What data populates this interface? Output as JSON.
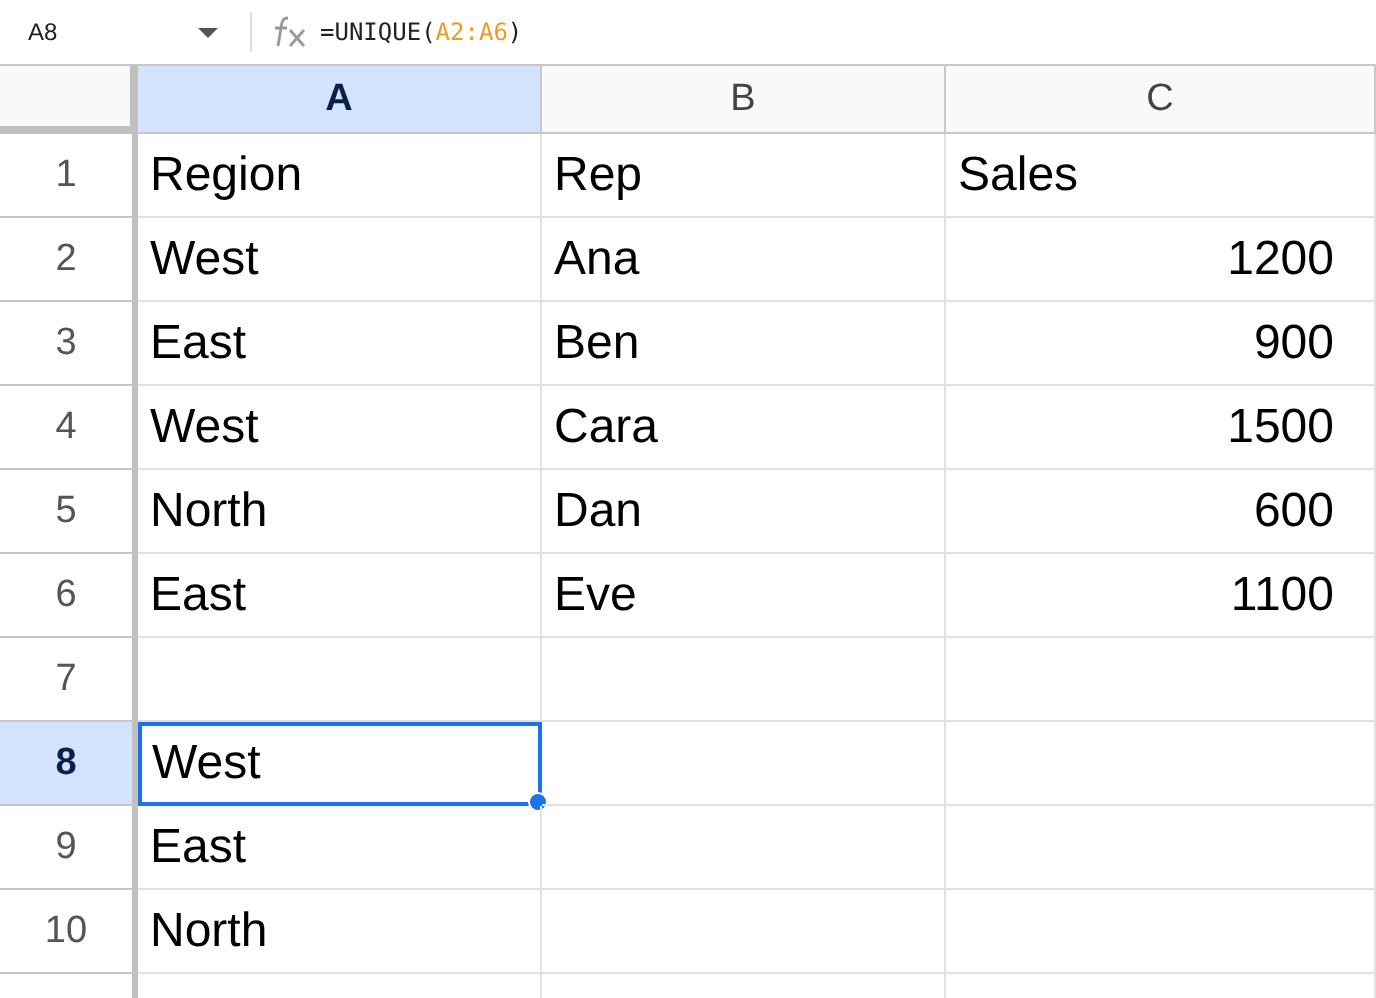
{
  "formula_bar": {
    "cell_ref": "A8",
    "formula_parts": [
      {
        "kind": "text",
        "text": "=UNIQUE("
      },
      {
        "kind": "ref",
        "text": "A2:A6"
      },
      {
        "kind": "text",
        "text": ")"
      }
    ]
  },
  "columns": [
    {
      "label": "A",
      "selected": true
    },
    {
      "label": "B",
      "selected": false
    },
    {
      "label": "C",
      "selected": false
    }
  ],
  "rows": [
    {
      "number": "1",
      "selected": false,
      "cells": [
        {
          "text": "Region",
          "kind": "text",
          "selected": false
        },
        {
          "text": "Rep",
          "kind": "text",
          "selected": false
        },
        {
          "text": "Sales",
          "kind": "text",
          "selected": false
        }
      ]
    },
    {
      "number": "2",
      "selected": false,
      "cells": [
        {
          "text": "West",
          "kind": "text",
          "selected": false
        },
        {
          "text": "Ana",
          "kind": "text",
          "selected": false
        },
        {
          "text": "1200",
          "kind": "number",
          "selected": false
        }
      ]
    },
    {
      "number": "3",
      "selected": false,
      "cells": [
        {
          "text": "East",
          "kind": "text",
          "selected": false
        },
        {
          "text": "Ben",
          "kind": "text",
          "selected": false
        },
        {
          "text": "900",
          "kind": "number",
          "selected": false
        }
      ]
    },
    {
      "number": "4",
      "selected": false,
      "cells": [
        {
          "text": "West",
          "kind": "text",
          "selected": false
        },
        {
          "text": "Cara",
          "kind": "text",
          "selected": false
        },
        {
          "text": "1500",
          "kind": "number",
          "selected": false
        }
      ]
    },
    {
      "number": "5",
      "selected": false,
      "cells": [
        {
          "text": "North",
          "kind": "text",
          "selected": false
        },
        {
          "text": "Dan",
          "kind": "text",
          "selected": false
        },
        {
          "text": "600",
          "kind": "number",
          "selected": false
        }
      ]
    },
    {
      "number": "6",
      "selected": false,
      "cells": [
        {
          "text": "East",
          "kind": "text",
          "selected": false
        },
        {
          "text": "Eve",
          "kind": "text",
          "selected": false
        },
        {
          "text": "1100",
          "kind": "number",
          "selected": false
        }
      ]
    },
    {
      "number": "7",
      "selected": false,
      "cells": [
        {
          "text": "",
          "kind": "text",
          "selected": false
        },
        {
          "text": "",
          "kind": "text",
          "selected": false
        },
        {
          "text": "",
          "kind": "text",
          "selected": false
        }
      ]
    },
    {
      "number": "8",
      "selected": true,
      "cells": [
        {
          "text": "West",
          "kind": "text",
          "selected": true
        },
        {
          "text": "",
          "kind": "text",
          "selected": false
        },
        {
          "text": "",
          "kind": "text",
          "selected": false
        }
      ]
    },
    {
      "number": "9",
      "selected": false,
      "cells": [
        {
          "text": "East",
          "kind": "text",
          "selected": false
        },
        {
          "text": "",
          "kind": "text",
          "selected": false
        },
        {
          "text": "",
          "kind": "text",
          "selected": false
        }
      ]
    },
    {
      "number": "10",
      "selected": false,
      "cells": [
        {
          "text": "North",
          "kind": "text",
          "selected": false
        },
        {
          "text": "",
          "kind": "text",
          "selected": false
        },
        {
          "text": "",
          "kind": "text",
          "selected": false
        }
      ]
    }
  ]
}
